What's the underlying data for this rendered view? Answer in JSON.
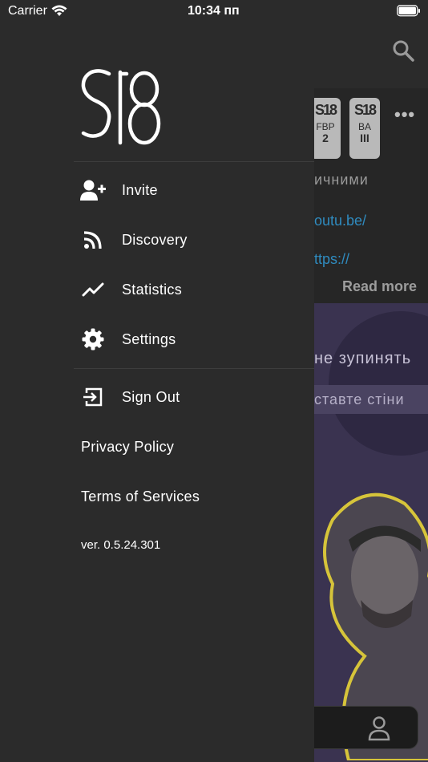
{
  "status_bar": {
    "carrier": "Carrier",
    "time": "10:34 пп"
  },
  "drawer": {
    "logo_name": "S18 logo",
    "menu": [
      {
        "label": "Invite",
        "icon": "add-user-icon"
      },
      {
        "label": "Discovery",
        "icon": "rss-feed-icon"
      },
      {
        "label": "Statistics",
        "icon": "trending-line-icon"
      },
      {
        "label": "Settings",
        "icon": "gear-icon"
      }
    ],
    "sign_out": {
      "label": "Sign Out",
      "icon": "sign-out-icon"
    },
    "privacy_policy": "Privacy Policy",
    "terms": "Terms of Services",
    "version": "ver. 0.5.24.301"
  },
  "background": {
    "badges": [
      {
        "line1": "FBP",
        "line2": "2"
      },
      {
        "line1": "BA",
        "line2": "III"
      }
    ],
    "text_grey": "ичними",
    "link1": "outu.be/",
    "link2": "ttps://",
    "read_more": "Read more",
    "banner_line1": "не зупинять",
    "banner_line2": "ставте стіни"
  },
  "colors": {
    "drawer_bg": "#2b2b2b",
    "link_blue": "#2f8bbf",
    "banner_purple": "#3a3350"
  }
}
